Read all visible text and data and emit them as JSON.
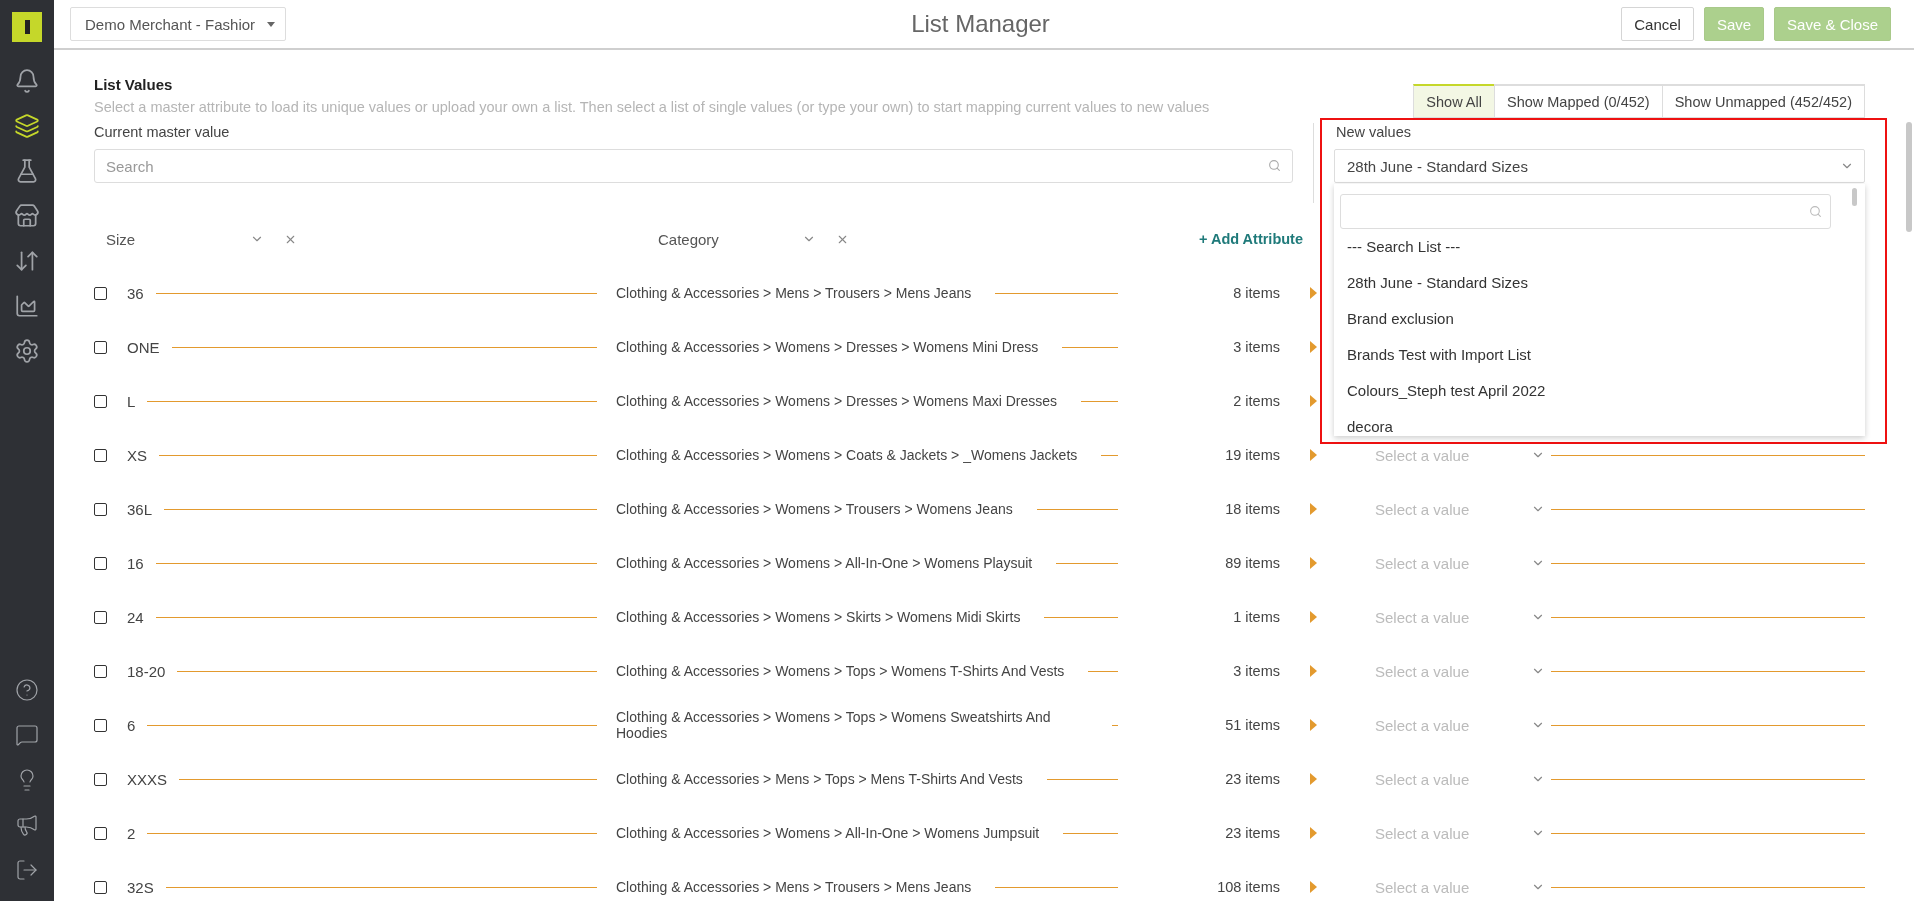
{
  "sidebar": {
    "items": [
      {
        "selected": false
      },
      {
        "selected": true
      },
      {
        "selected": false
      },
      {
        "selected": false
      },
      {
        "selected": false
      },
      {
        "selected": false
      },
      {
        "selected": false
      }
    ],
    "bottom_items": [
      {
        "selected": false
      },
      {
        "selected": false
      },
      {
        "selected": false
      },
      {
        "selected": false
      },
      {
        "selected": false
      }
    ]
  },
  "topbar": {
    "merchant": "Demo Merchant - Fashior",
    "title": "List Manager",
    "buttons": [
      {
        "label": "Cancel",
        "kind": "plain"
      },
      {
        "label": "Save",
        "kind": "primary"
      },
      {
        "label": "Save & Close",
        "kind": "primary"
      }
    ]
  },
  "header": {
    "title": "List Values",
    "subtitle": "Select a master attribute to load its unique values or upload your own a list. Then select a list of single values (or type your own) to start mapping current values to new values",
    "master_label": "Current master value",
    "search": {
      "placeholder": "Search"
    }
  },
  "filters": [
    {
      "label": "Show All",
      "selected": true
    },
    {
      "label": "Show Mapped (0/452)",
      "selected": false
    },
    {
      "label": "Show Unmapped (452/452)",
      "selected": false
    }
  ],
  "new_values": {
    "label": "New values",
    "value": "28th June - Standard Sizes",
    "highlighted": true,
    "expanded": true,
    "options": [
      "--- Search List ---",
      "28th June - Standard Sizes",
      "Brand exclusion",
      "Brands Test with Import List",
      "Colours_Steph test April 2022",
      "decora"
    ]
  },
  "attributes": [
    "Size",
    "Category"
  ],
  "add_attribute": "+ Add Attribute",
  "rows": [
    {
      "value": "36",
      "category": "Clothing & Accessories > Mens > Trousers > Mens Jeans",
      "count": "8 items",
      "checked": false
    },
    {
      "value": "ONE",
      "category": "Clothing & Accessories > Womens > Dresses > Womens Mini Dress",
      "count": "3 items",
      "checked": false
    },
    {
      "value": "L",
      "category": "Clothing & Accessories > Womens > Dresses > Womens Maxi Dresses",
      "count": "2 items",
      "checked": false
    },
    {
      "value": "XS",
      "category": "Clothing & Accessories > Womens > Coats & Jackets > _Womens Jackets",
      "count": "19 items",
      "checked": false,
      "placeholder": "Select a value"
    },
    {
      "value": "36L",
      "category": "Clothing & Accessories > Womens > Trousers > Womens Jeans",
      "count": "18 items",
      "checked": false,
      "placeholder": "Select a value"
    },
    {
      "value": "16",
      "category": "Clothing & Accessories > Womens > All-In-One > Womens Playsuit",
      "count": "89 items",
      "checked": false,
      "placeholder": "Select a value"
    },
    {
      "value": "24",
      "category": "Clothing & Accessories > Womens > Skirts > Womens Midi Skirts",
      "count": "1 items",
      "checked": false,
      "placeholder": "Select a value"
    },
    {
      "value": "18-20",
      "category": "Clothing & Accessories > Womens > Tops > Womens T-Shirts And Vests",
      "count": "3 items",
      "checked": false,
      "placeholder": "Select a value"
    },
    {
      "value": "6",
      "category": "Clothing & Accessories > Womens > Tops > Womens Sweatshirts And Hoodies",
      "count": "51 items",
      "checked": false,
      "placeholder": "Select a value"
    },
    {
      "value": "XXXS",
      "category": "Clothing & Accessories > Mens > Tops > Mens T-Shirts And Vests",
      "count": "23 items",
      "checked": false,
      "placeholder": "Select a value"
    },
    {
      "value": "2",
      "category": "Clothing & Accessories > Womens > All-In-One > Womens Jumpsuit",
      "count": "23 items",
      "checked": false,
      "placeholder": "Select a value"
    },
    {
      "value": "32S",
      "category": "Clothing & Accessories > Mens > Trousers > Mens Jeans",
      "count": "108 items",
      "checked": false,
      "placeholder": "Select a value"
    }
  ]
}
